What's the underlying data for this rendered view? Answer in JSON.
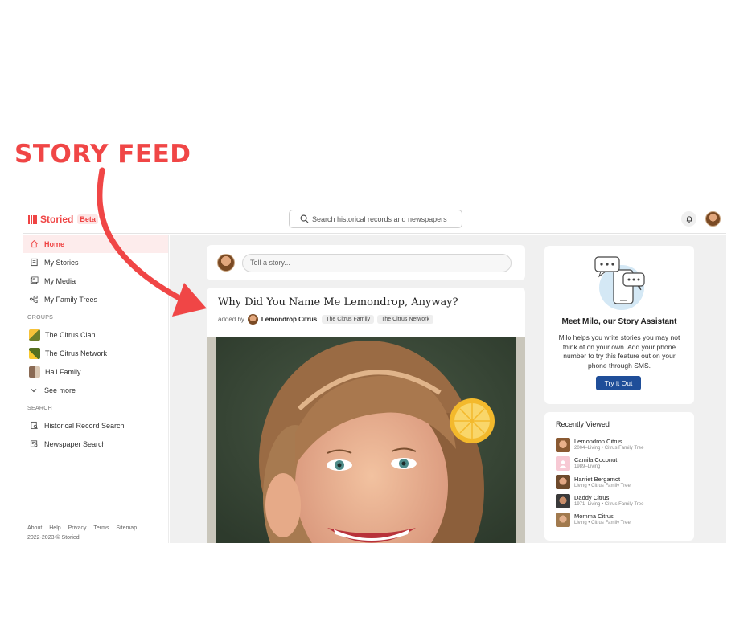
{
  "annotation": {
    "label": "STORY FEED",
    "color": "#f04646"
  },
  "topbar": {
    "logo_text": "Storied",
    "beta_label": "Beta",
    "search_placeholder": "Search historical records and newspapers",
    "notification_icon": "bell-icon",
    "profile_icon": "avatar"
  },
  "sidebar": {
    "main_items": [
      {
        "label": "Home",
        "icon": "home-icon",
        "active": true
      },
      {
        "label": "My Stories",
        "icon": "book-icon"
      },
      {
        "label": "My Media",
        "icon": "media-icon"
      },
      {
        "label": "My Family Trees",
        "icon": "tree-icon"
      }
    ],
    "groups_label": "GROUPS",
    "groups": [
      {
        "label": "The Citrus Clan"
      },
      {
        "label": "The Citrus Network"
      },
      {
        "label": "Hall Family"
      }
    ],
    "see_more_label": "See more",
    "search_label": "SEARCH",
    "search_items": [
      {
        "label": "Historical Record Search",
        "icon": "record-search-icon"
      },
      {
        "label": "Newspaper Search",
        "icon": "newspaper-icon"
      }
    ],
    "footer_links": [
      "About",
      "Help",
      "Privacy",
      "Terms",
      "Sitemap"
    ],
    "copyright": "2022-2023 © Storied"
  },
  "composer": {
    "placeholder": "Tell a story..."
  },
  "story": {
    "title": "Why Did You Name Me Lemondrop, Anyway?",
    "added_by_label": "added by",
    "author": "Lemondrop Citrus",
    "tags": [
      "The Citrus Family",
      "The Citrus Network"
    ]
  },
  "milo": {
    "title": "Meet Milo, our Story Assistant",
    "description": "Milo helps you write stories you may not think of on your own. Add your phone number to try this feature out on your phone through SMS.",
    "button_label": "Try it Out"
  },
  "recently_viewed": {
    "title": "Recently Viewed",
    "items": [
      {
        "name": "Lemondrop Citrus",
        "meta": "2004–Living • Citrus Family Tree"
      },
      {
        "name": "Camila Coconut",
        "meta": "1989–Living"
      },
      {
        "name": "Harriet Bergamot",
        "meta": "Living • Citrus Family Tree"
      },
      {
        "name": "Daddy Citrus",
        "meta": "1971–Living • Citrus Family Tree"
      },
      {
        "name": "Momma Citrus",
        "meta": "Living • Citrus Family Tree"
      }
    ]
  },
  "colors": {
    "brand": "#ef4444",
    "button": "#1f4e99",
    "content_bg": "#f0f0f0"
  }
}
